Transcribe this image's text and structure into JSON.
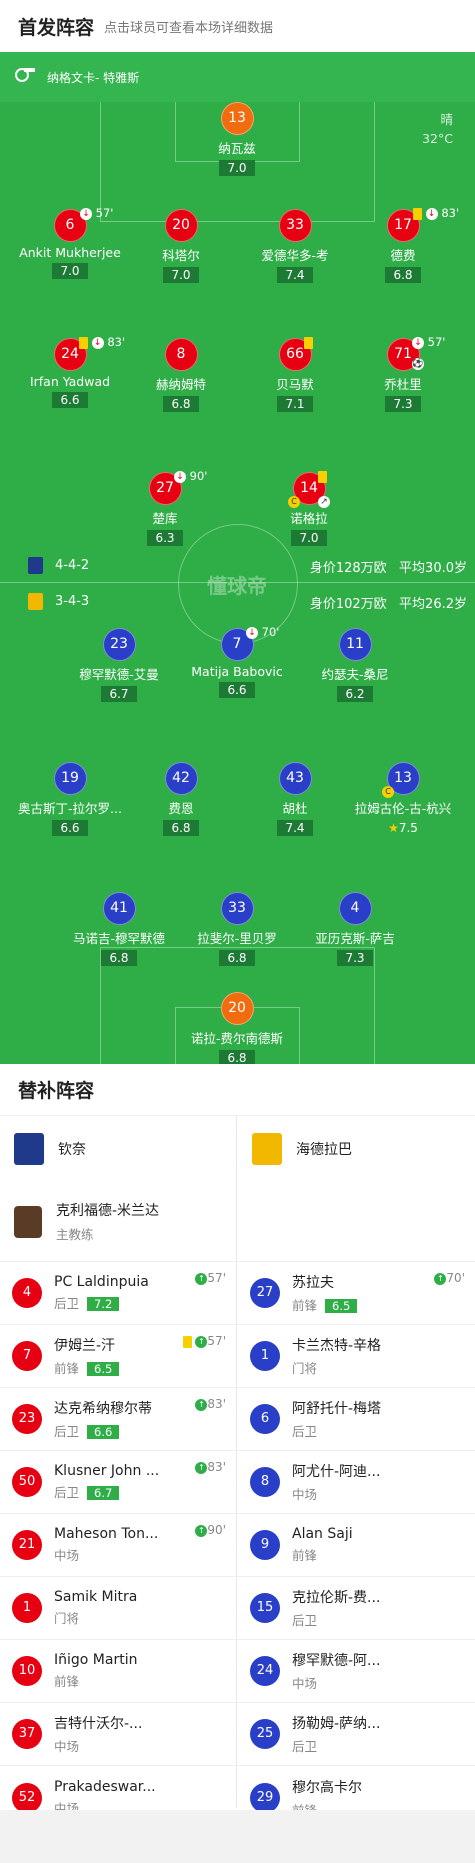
{
  "header": {
    "title": "首发阵容",
    "subtitle": "点击球员可查看本场详细数据"
  },
  "referee": {
    "name": "纳格文卡- 特雅斯"
  },
  "weather": {
    "condition": "晴",
    "temp": "32°C"
  },
  "watermark": "懂球帝",
  "home_team": {
    "formation": "4-4-2",
    "value": "身价128万欧",
    "age": "平均30.0岁",
    "players": [
      {
        "num": "13",
        "name": "纳瓦兹",
        "rating": "7.0"
      },
      {
        "num": "6",
        "name": "Ankit Mukherjee",
        "rating": "7.0",
        "event": "57'"
      },
      {
        "num": "20",
        "name": "科塔尔",
        "rating": "7.0"
      },
      {
        "num": "33",
        "name": "爱德华多-考",
        "rating": "7.4"
      },
      {
        "num": "17",
        "name": "德费",
        "rating": "6.8",
        "event": "83'"
      },
      {
        "num": "24",
        "name": "Irfan Yadwad",
        "rating": "6.6",
        "event": "83'"
      },
      {
        "num": "8",
        "name": "赫纳姆特",
        "rating": "6.8"
      },
      {
        "num": "66",
        "name": "贝马默",
        "rating": "7.1"
      },
      {
        "num": "71",
        "name": "乔杜里",
        "rating": "7.3",
        "event": "57'"
      },
      {
        "num": "27",
        "name": "楚库",
        "rating": "6.3",
        "event": "90'"
      },
      {
        "num": "14",
        "name": "诺格拉",
        "rating": "7.0"
      }
    ]
  },
  "away_team": {
    "formation": "3-4-3",
    "value": "身价102万欧",
    "age": "平均26.2岁",
    "players": [
      {
        "num": "23",
        "name": "穆罕默德-艾曼",
        "rating": "6.7"
      },
      {
        "num": "7",
        "name": "Matija Babovic",
        "rating": "6.6",
        "event": "70'"
      },
      {
        "num": "11",
        "name": "约瑟夫-桑尼",
        "rating": "6.2"
      },
      {
        "num": "19",
        "name": "奥古斯丁-拉尔罗...",
        "rating": "6.6"
      },
      {
        "num": "42",
        "name": "费恩",
        "rating": "6.8"
      },
      {
        "num": "43",
        "name": "胡杜",
        "rating": "7.4"
      },
      {
        "num": "13",
        "name": "拉姆古伦-古-杭兴",
        "rating": "7.5"
      },
      {
        "num": "41",
        "name": "马诺吉-穆罕默德",
        "rating": "6.8"
      },
      {
        "num": "33",
        "name": "拉斐尔-里贝罗",
        "rating": "6.8"
      },
      {
        "num": "4",
        "name": "亚历克斯-萨吉",
        "rating": "7.3"
      },
      {
        "num": "20",
        "name": "诺拉-费尔南德斯",
        "rating": "6.8"
      }
    ]
  },
  "subs": {
    "title": "替补阵容",
    "left": {
      "team": "钦奈",
      "coach": {
        "name": "克利福德-米兰达",
        "role": "主教练"
      },
      "players": [
        {
          "num": "4",
          "name": "PC Laldinpuia",
          "pos": "后卫",
          "rating": "7.2",
          "event": "57'"
        },
        {
          "num": "7",
          "name": "伊姆兰-汗",
          "pos": "前锋",
          "rating": "6.5",
          "event": "57'"
        },
        {
          "num": "23",
          "name": "达克希纳穆尔蒂",
          "pos": "后卫",
          "rating": "6.6",
          "event": "83'"
        },
        {
          "num": "50",
          "name": "Klusner John ...",
          "pos": "后卫",
          "rating": "6.7",
          "event": "83'"
        },
        {
          "num": "21",
          "name": "Maheson Ton...",
          "pos": "中场",
          "event": "90'"
        },
        {
          "num": "1",
          "name": "Samik Mitra",
          "pos": "门将"
        },
        {
          "num": "10",
          "name": "Iñigo Martin",
          "pos": "前锋"
        },
        {
          "num": "37",
          "name": "吉特什沃尔-...",
          "pos": "中场"
        },
        {
          "num": "52",
          "name": "Prakadeswar...",
          "pos": "中场"
        }
      ]
    },
    "right": {
      "team": "海德拉巴",
      "players": [
        {
          "num": "27",
          "name": "苏拉夫",
          "pos": "前锋",
          "rating": "6.5",
          "event": "70'"
        },
        {
          "num": "1",
          "name": "卡兰杰特-辛格",
          "pos": "门将"
        },
        {
          "num": "6",
          "name": "阿舒托什-梅塔",
          "pos": "后卫"
        },
        {
          "num": "8",
          "name": "阿尤什-阿迪...",
          "pos": "中场"
        },
        {
          "num": "9",
          "name": "Alan Saji",
          "pos": "前锋"
        },
        {
          "num": "15",
          "name": "克拉伦斯-费...",
          "pos": "后卫"
        },
        {
          "num": "24",
          "name": "穆罕默德-阿...",
          "pos": "中场"
        },
        {
          "num": "25",
          "name": "扬勒姆-萨纳...",
          "pos": "后卫"
        },
        {
          "num": "29",
          "name": "穆尔高卡尔",
          "pos": "前锋"
        }
      ]
    }
  }
}
